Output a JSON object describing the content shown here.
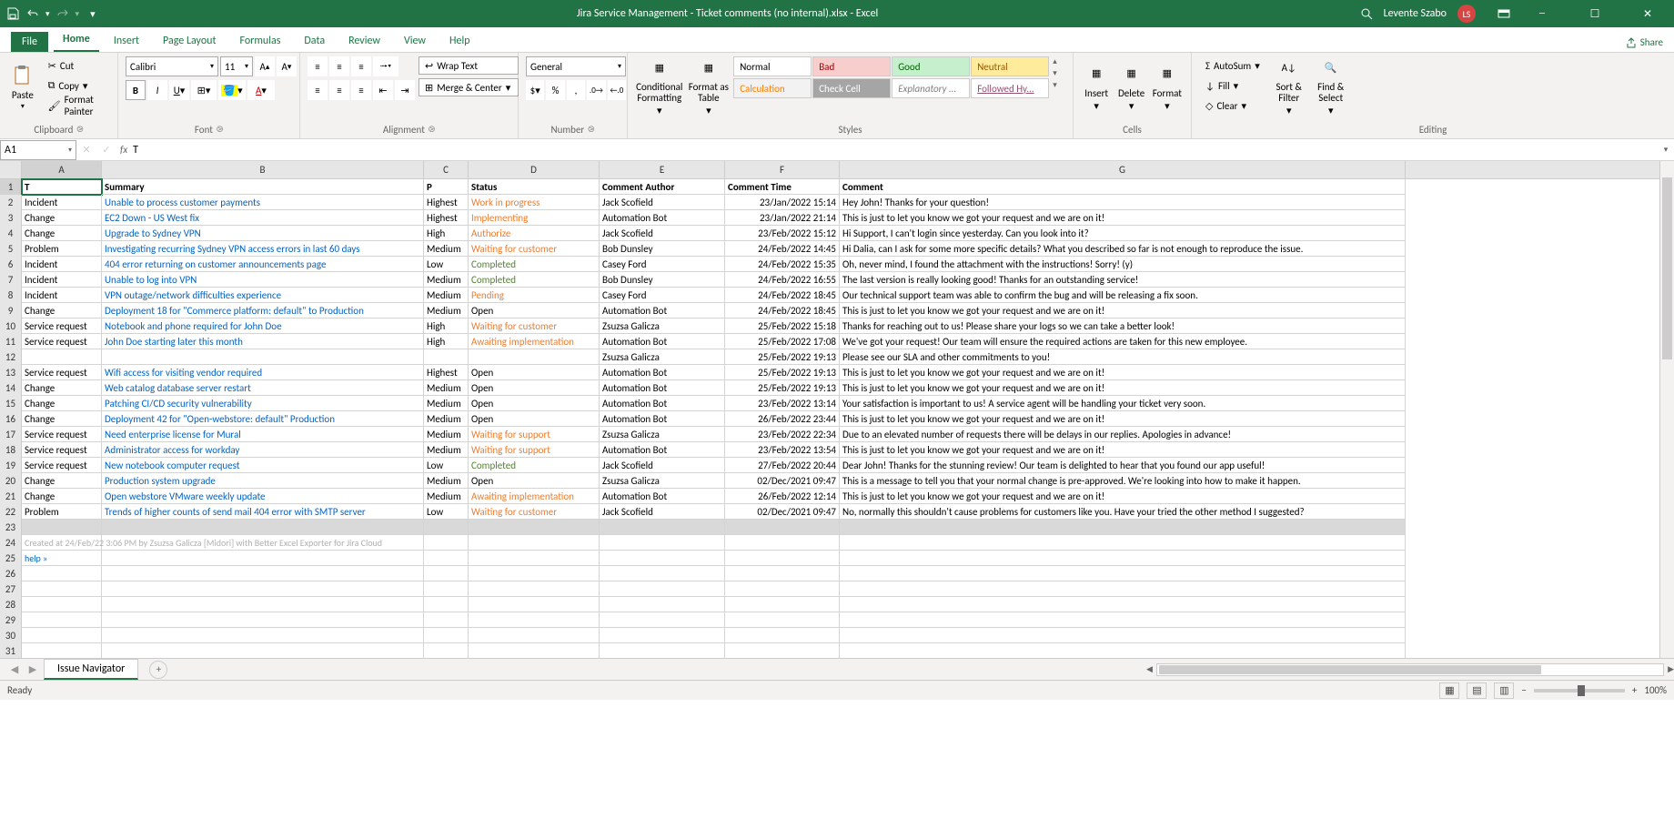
{
  "title": "Jira Service Management - Ticket comments (no internal).xlsx  -  Excel",
  "user": {
    "name": "Levente Szabo",
    "initials": "LS"
  },
  "tabs": {
    "file": "File",
    "home": "Home",
    "insert": "Insert",
    "page": "Page Layout",
    "formulas": "Formulas",
    "data": "Data",
    "review": "Review",
    "view": "View",
    "help": "Help",
    "share": "Share"
  },
  "ribbon": {
    "clipboard": {
      "paste": "Paste",
      "cut": "Cut",
      "copy": "Copy",
      "fp": "Format Painter",
      "label": "Clipboard"
    },
    "font": {
      "name": "Calibri",
      "size": "11",
      "label": "Font"
    },
    "align": {
      "wrap": "Wrap Text",
      "merge": "Merge & Center",
      "label": "Alignment"
    },
    "number": {
      "style": "General",
      "label": "Number"
    },
    "styles": {
      "cf": "Conditional Formatting",
      "fat": "Format as Table",
      "normal": "Normal",
      "bad": "Bad",
      "good": "Good",
      "neutral": "Neutral",
      "calc": "Calculation",
      "check": "Check Cell",
      "expl": "Explanatory ...",
      "link": "Followed Hy...",
      "label": "Styles"
    },
    "cells": {
      "insert": "Insert",
      "delete": "Delete",
      "format": "Format",
      "label": "Cells"
    },
    "editing": {
      "sum": "AutoSum",
      "fill": "Fill",
      "clear": "Clear",
      "sort": "Sort & Filter",
      "find": "Find & Select",
      "label": "Editing"
    }
  },
  "fbar": {
    "name": "A1",
    "value": "T"
  },
  "cols": [
    "A",
    "B",
    "C",
    "D",
    "E",
    "F",
    "G"
  ],
  "headers": {
    "t": "T",
    "summary": "Summary",
    "p": "P",
    "status": "Status",
    "author": "Comment Author",
    "time": "Comment Time",
    "comment": "Comment"
  },
  "rows": [
    {
      "t": "Incident",
      "s": "Unable to process customer payments",
      "p": "Highest",
      "st": "Work in progress",
      "stc": "orange",
      "a": "Jack Scofield",
      "tm": "23/Jan/2022 15:14",
      "c": "Hey John! Thanks for your question!"
    },
    {
      "t": "Change",
      "s": "EC2 Down - US West fix",
      "p": "Highest",
      "st": "Implementing",
      "stc": "orange",
      "a": "Automation Bot",
      "tm": "23/Jan/2022 21:14",
      "c": "This is just to let you know we got your request and we are on it!"
    },
    {
      "t": "Change",
      "s": "Upgrade to Sydney VPN",
      "p": "High",
      "st": "Authorize",
      "stc": "orange",
      "a": "Jack Scofield",
      "tm": "23/Feb/2022 15:12",
      "c": "Hi Support, I can't login since yesterday. Can you look into it?"
    },
    {
      "t": "Problem",
      "s": "Investigating recurring Sydney VPN access errors in last 60 days",
      "p": "Medium",
      "st": "Waiting for customer",
      "stc": "orange",
      "a": "Bob Dunsley",
      "tm": "24/Feb/2022 14:45",
      "c": "Hi Dalia, can I ask for some more specific details? What you described so far is not enough to reproduce the issue."
    },
    {
      "t": "Incident",
      "s": "404 error returning on customer announcements page",
      "p": "Low",
      "st": "Completed",
      "stc": "green",
      "a": "Casey Ford",
      "tm": "24/Feb/2022 15:35",
      "c": "Oh, never mind, I found the attachment with the instructions! Sorry! (y)"
    },
    {
      "t": "Incident",
      "s": "Unable to log into VPN",
      "p": "Medium",
      "st": "Completed",
      "stc": "green",
      "a": "Bob Dunsley",
      "tm": "24/Feb/2022 16:55",
      "c": "The last version is really looking good! Thanks for an outstanding service!"
    },
    {
      "t": "Incident",
      "s": "VPN outage/network difficulties experience",
      "p": "Medium",
      "st": "Pending",
      "stc": "orange",
      "a": "Casey Ford",
      "tm": "24/Feb/2022 18:45",
      "c": "Our technical support team was able to confirm the bug and will be releasing a fix soon."
    },
    {
      "t": "Change",
      "s": "Deployment 18 for \"Commerce platform: default\" to Production",
      "p": "Medium",
      "st": "Open",
      "stc": "",
      "a": "Automation Bot",
      "tm": "24/Feb/2022 18:45",
      "c": "This is just to let you know we got your request and we are on it!"
    },
    {
      "t": "Service request",
      "s": "Notebook and phone required for John Doe",
      "p": "High",
      "st": "Waiting for customer",
      "stc": "orange",
      "a": "Zsuzsa Galicza",
      "tm": "25/Feb/2022 15:18",
      "c": "Thanks for reaching out to us! Please share your logs so we can take a better look!"
    },
    {
      "t": "Service request",
      "s": "John Doe starting later this month",
      "p": "High",
      "st": "Awaiting implementation",
      "stc": "orange",
      "a": "Automation Bot",
      "tm": "25/Feb/2022 17:08",
      "c": "We've got your request! Our team will ensure the required actions are taken for this new employee."
    },
    {
      "t": "",
      "s": "",
      "p": "",
      "st": "",
      "stc": "",
      "a": "Zsuzsa Galicza",
      "tm": "25/Feb/2022 19:13",
      "c": "Please see our SLA and other commitments to you!"
    },
    {
      "t": "Service request",
      "s": "Wifi access for visiting vendor required",
      "p": "Highest",
      "st": "Open",
      "stc": "",
      "a": "Automation Bot",
      "tm": "25/Feb/2022 19:13",
      "c": "This is just to let you know we got your request and we are on it!"
    },
    {
      "t": "Change",
      "s": "Web catalog database server restart",
      "p": "Medium",
      "st": "Open",
      "stc": "",
      "a": "Automation Bot",
      "tm": "25/Feb/2022 19:13",
      "c": "This is just to let you know we got your request and we are on it!"
    },
    {
      "t": "Change",
      "s": "Patching CI/CD security vulnerability",
      "p": "Medium",
      "st": "Open",
      "stc": "",
      "a": "Automation Bot",
      "tm": "23/Feb/2022 13:14",
      "c": "Your satisfaction is important to us! A service agent will be handling your ticket very soon."
    },
    {
      "t": "Change",
      "s": "Deployment 42 for \"Open-webstore: default\" Production",
      "p": "Medium",
      "st": "Open",
      "stc": "",
      "a": "Automation Bot",
      "tm": "26/Feb/2022 23:44",
      "c": "This is just to let you know we got your request and we are on it!"
    },
    {
      "t": "Service request",
      "s": "Need enterprise license for Mural",
      "p": "Medium",
      "st": "Waiting for support",
      "stc": "orange",
      "a": "Zsuzsa Galicza",
      "tm": "23/Feb/2022 22:34",
      "c": "Due to an elevated number of requests there will be delays in our replies. Apologies in advance!"
    },
    {
      "t": "Service request",
      "s": "Administrator access for workday",
      "p": "Medium",
      "st": "Waiting for support",
      "stc": "orange",
      "a": "Automation Bot",
      "tm": "23/Feb/2022 13:54",
      "c": "This is just to let you know we got your request and we are on it!"
    },
    {
      "t": "Service request",
      "s": "New notebook computer request",
      "p": "Low",
      "st": "Completed",
      "stc": "green",
      "a": "Jack Scofield",
      "tm": "27/Feb/2022 20:44",
      "c": "Dear John! Thanks for the stunning review! Our team is delighted to hear that you found our app useful!"
    },
    {
      "t": "Change",
      "s": "Production system upgrade",
      "p": "Medium",
      "st": "Open",
      "stc": "",
      "a": "Zsuzsa Galicza",
      "tm": "02/Dec/2021 09:47",
      "c": "This is a message to tell you that your normal change is pre-approved. We're looking into how to make it happen."
    },
    {
      "t": "Change",
      "s": "Open webstore VMware weekly update",
      "p": "Medium",
      "st": "Awaiting implementation",
      "stc": "orange",
      "a": "Automation Bot",
      "tm": "26/Feb/2022 12:14",
      "c": "This is just to let you know we got your request and we are on it!"
    },
    {
      "t": "Problem",
      "s": "Trends of higher counts of send mail 404 error with SMTP server",
      "p": "Low",
      "st": "Waiting for customer",
      "stc": "orange",
      "a": "Jack Scofield",
      "tm": "02/Dec/2021 09:47",
      "c": "No, normally this shouldn't cause problems for customers like you. Have your tried the other method I suggested?"
    }
  ],
  "meta": "Created at 24/Feb/22 3:06 PM by Zsuzsa Galicza [Midori] with Better Excel Exporter for Jira Cloud",
  "help": "help »",
  "sheet": "Issue Navigator",
  "status": {
    "ready": "Ready",
    "zoom": "100%"
  }
}
